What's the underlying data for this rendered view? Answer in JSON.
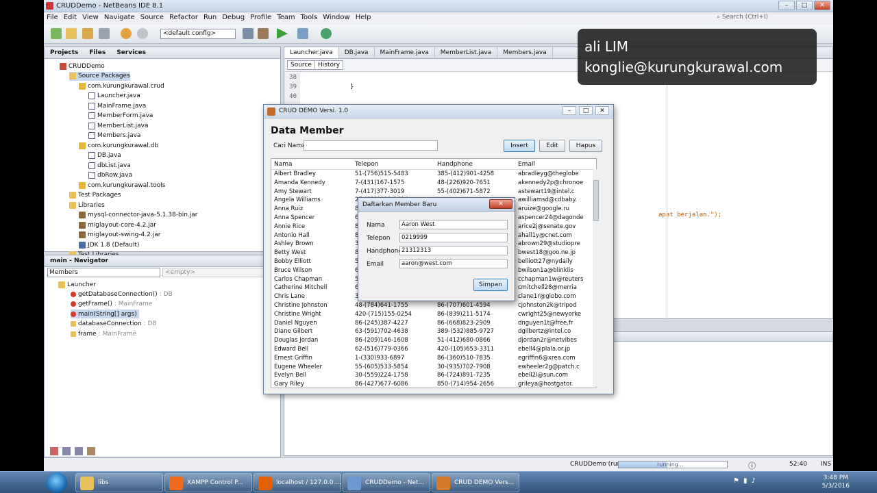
{
  "ide": {
    "title": "CRUDDemo - NetBeans IDE 8.1",
    "menu": [
      "File",
      "Edit",
      "View",
      "Navigate",
      "Source",
      "Refactor",
      "Run",
      "Debug",
      "Profile",
      "Team",
      "Tools",
      "Window",
      "Help"
    ],
    "search_placeholder": "Search (Ctrl+I)",
    "config": "<default config>"
  },
  "projects": {
    "tabs": [
      "Projects",
      "Files",
      "Services"
    ],
    "tree": [
      {
        "label": "CRUDDemo",
        "icon": "project-icon"
      },
      {
        "label": "Source Packages",
        "icon": "folder-icon"
      },
      {
        "label": "com.kurungkurawal.crud",
        "icon": "package-icon"
      },
      {
        "label": "Launcher.java",
        "icon": "java-file-icon"
      },
      {
        "label": "MainFrame.java",
        "icon": "java-file-icon"
      },
      {
        "label": "MemberForm.java",
        "icon": "java-file-icon"
      },
      {
        "label": "MemberList.java",
        "icon": "java-file-icon"
      },
      {
        "label": "Members.java",
        "icon": "java-file-icon"
      },
      {
        "label": "com.kurungkurawal.db",
        "icon": "package-icon"
      },
      {
        "label": "DB.java",
        "icon": "java-file-icon"
      },
      {
        "label": "dbList.java",
        "icon": "java-file-icon"
      },
      {
        "label": "dbRow.java",
        "icon": "java-file-icon"
      },
      {
        "label": "com.kurungkurawal.tools",
        "icon": "package-icon"
      },
      {
        "label": "Test Packages",
        "icon": "folder-icon"
      },
      {
        "label": "Libraries",
        "icon": "folder-icon"
      },
      {
        "label": "mysql-connector-java-5.1.38-bin.jar",
        "icon": "jar-icon"
      },
      {
        "label": "miglayout-core-4.2.jar",
        "icon": "jar-icon"
      },
      {
        "label": "miglayout-swing-4.2.jar",
        "icon": "jar-icon"
      },
      {
        "label": "JDK 1.8 (Default)",
        "icon": "jdk-icon"
      },
      {
        "label": "Test Libraries",
        "icon": "folder-icon"
      }
    ]
  },
  "navigator": {
    "title": "main - Navigator",
    "combo": "Members",
    "empty": "<empty>",
    "root": "Launcher",
    "items": [
      {
        "name": "getDatabaseConnection()",
        "type": " : DB"
      },
      {
        "name": "getFrame()",
        "type": " : MainFrame"
      },
      {
        "name": "main(String[] args)",
        "type": ""
      },
      {
        "name": "databaseConnection",
        "type": " : DB"
      },
      {
        "name": "frame",
        "type": " : MainFrame"
      }
    ]
  },
  "editor": {
    "tabs": [
      "Launcher.java",
      "DB.java",
      "MainFrame.java",
      "MemberList.java",
      "Members.java"
    ],
    "source_btn": "Source",
    "history_btn": "History",
    "lines": [
      "38",
      "39",
      "40"
    ],
    "code_brace": "}",
    "code_snippet": "apat berjalan.\");"
  },
  "status": {
    "run": "CRUDDemo (run)",
    "running": "running...",
    "progress": 0.45,
    "position": "52:40",
    "mode": "INS"
  },
  "crud": {
    "window_title": "CRUD DEMO Versi. 1.0",
    "heading": "Data Member",
    "search_label": "Cari Nama",
    "insert": "Insert",
    "edit": "Edit",
    "delete": "Hapus",
    "columns": [
      "Nama",
      "Telepon",
      "Handphone",
      "Email"
    ],
    "rows": [
      [
        "Albert Bradley",
        "51-(756)515-5483",
        "385-(412)901-4258",
        "abradleyg@theglobe"
      ],
      [
        "Amanda Kennedy",
        "7-(431)167-1575",
        "48-(226)920-7651",
        "akennedy2p@chronoe"
      ],
      [
        "Amy Stewart",
        "7-(417)377-3019",
        "55-(402)671-5872",
        "astewart19@intel.c"
      ],
      [
        "Angela Williams",
        "27-(681)919-3694",
        "",
        "awilliamsd@cdbaby."
      ],
      [
        "Anna Ruiz",
        "86",
        "",
        "aruize@google.ru"
      ],
      [
        "Anna Spencer",
        "62",
        "",
        "aspencer24@dagonde"
      ],
      [
        "Annie Rice",
        "86",
        "",
        "arice2j@senate.gov"
      ],
      [
        "Antonio Hall",
        "86",
        "",
        "ahall1y@cnet.com"
      ],
      [
        "Ashley Brown",
        "30",
        "",
        "abrown29@studiopre"
      ],
      [
        "Betty West",
        "86",
        "",
        "bwest18@goo.ne.jp"
      ],
      [
        "Bobby Elliott",
        "51",
        "",
        "belliott27@nydaily"
      ],
      [
        "Bruce Wilson",
        "62",
        "",
        "bwilson1a@blinklis"
      ],
      [
        "Carlos Chapman",
        "55",
        "",
        "cchapman1w@reuters"
      ],
      [
        "Catherine Mitchell",
        "62",
        "",
        "cmitchell28@merria"
      ],
      [
        "Chris Lane",
        "33",
        "",
        "clane1r@globo.com"
      ],
      [
        "Christine Johnston",
        "48-(784)641-1755",
        "86-(707)601-4594",
        "cjohnston2k@tripod"
      ],
      [
        "Christine Wright",
        "420-(715)155-0254",
        "86-(839)211-5174",
        "cwright25@newyorke"
      ],
      [
        "Daniel Nguyen",
        "86-(245)387-4227",
        "86-(668)823-2909",
        "dnguyen1t@free.fr"
      ],
      [
        "Diane Gilbert",
        "63-(591)702-4638",
        "389-(532)885-9727",
        "dgilbertz@intel.co"
      ],
      [
        "Douglas Jordan",
        "86-(209)146-1608",
        "51-(412)680-0866",
        "djordan2r@netvibes"
      ],
      [
        "Edward Bell",
        "62-(516)779-0366",
        "420-(105)653-3311",
        "ebell4@plala.or.jp"
      ],
      [
        "Ernest Griffin",
        "1-(330)933-6897",
        "86-(360)510-7835",
        "egriffin6@xrea.com"
      ],
      [
        "Eugene Wheeler",
        "55-(605)533-5854",
        "30-(935)702-7908",
        "ewheeler2g@patch.c"
      ],
      [
        "Evelyn Bell",
        "30-(559)224-1758",
        "86-(724)891-7235",
        "ebell2l@sun.com"
      ],
      [
        "Gary Riley",
        "86-(427)677-6086",
        "850-(714)954-2656",
        "grileya@hostgator."
      ]
    ]
  },
  "dialog": {
    "title": "Daftarkan Member Baru",
    "close": "✕",
    "fields": [
      {
        "label": "Nama",
        "value": "Aaron West"
      },
      {
        "label": "Telepon",
        "value": "0219999"
      },
      {
        "label": "Handphone",
        "value": "21312313"
      },
      {
        "label": "Email",
        "value": "aaron@west.com"
      }
    ],
    "save": "Simpan"
  },
  "overlay": {
    "name": "ali LIM",
    "email": "konglie@kurungkurawal.com"
  },
  "taskbar": {
    "items": [
      {
        "label": "libs",
        "color": "#e8c15a"
      },
      {
        "label": "XAMPP Control P...",
        "color": "#f26b1d"
      },
      {
        "label": "localhost / 127.0.0....",
        "color": "#e66000"
      },
      {
        "label": "CRUDDemo - Net...",
        "color": "#6d9bd1"
      },
      {
        "label": "CRUD DEMO Vers...",
        "color": "#d47a2a"
      }
    ],
    "time": "3:48 PM",
    "date": "5/3/2016"
  }
}
